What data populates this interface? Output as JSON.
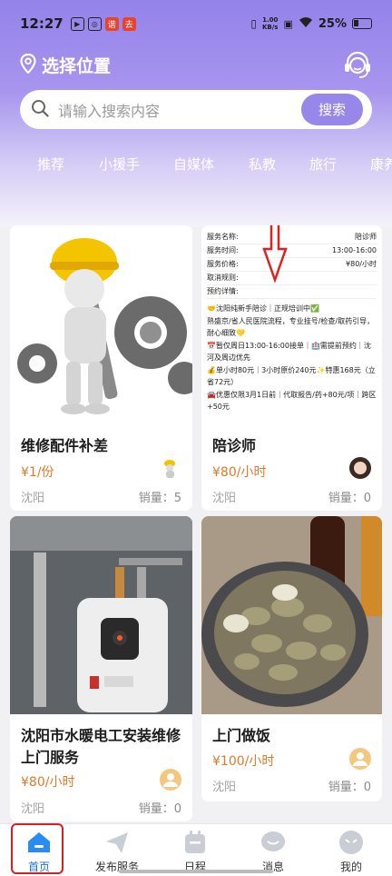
{
  "status": {
    "time": "12:27",
    "app_badge_1": "谐",
    "app_badge_2": "去",
    "speed": "1.00\nKB/s",
    "battery": "25%"
  },
  "header": {
    "location_label": "选择位置",
    "search_placeholder": "请输入搜索内容",
    "search_button": "搜索"
  },
  "categories": [
    "推荐",
    "小援手",
    "自媒体",
    "私教",
    "旅行",
    "康养"
  ],
  "cards": [
    {
      "title": "维修配件补差",
      "price": "¥1/份",
      "city": "沈阳",
      "sales": "销量：5"
    },
    {
      "title": "陪诊师",
      "price": "¥80/小时",
      "city": "沈阳",
      "sales": "销量：0"
    },
    {
      "title": "沈阳市水暖电工安装维修上门服务",
      "price": "¥80/小时",
      "city": "沈阳",
      "sales": "销量：0"
    },
    {
      "title": "上门做饭",
      "price": "¥100/小时",
      "city": "沈阳",
      "sales": "销量：0"
    }
  ],
  "escort_image": {
    "rows": [
      {
        "k": "服务名称:",
        "v": "陪诊师"
      },
      {
        "k": "服务时间:",
        "v": "13:00-16:00"
      },
      {
        "k": "服务价格:",
        "v": "¥80/小时"
      },
      {
        "k": "取消规则:",
        "v": ""
      },
      {
        "k": "预约详情:",
        "v": ""
      }
    ],
    "desc": [
      "🤝沈阳纯新手陪诊｜正规培训中✅",
      "熟盛京/省人民医院流程，专业挂号/检查/取药引导，耐心细致💛",
      "📅暂仅周日13:00-16:00接单｜🏥需提前预约｜沈河及周边优先",
      "💰单小时80元｜3小时原价240元✨特惠168元（立省72元）",
      "🚘优惠仅限3月1日前｜代取报告/药+80元/项｜跨区+50元"
    ]
  },
  "bottom_nav": [
    {
      "label": "首页"
    },
    {
      "label": "发布服务"
    },
    {
      "label": "日程"
    },
    {
      "label": "消息"
    },
    {
      "label": "我的"
    }
  ],
  "colors": {
    "accent": "#9787e8",
    "price": "#e07a2a",
    "highlight": "#d92020"
  }
}
